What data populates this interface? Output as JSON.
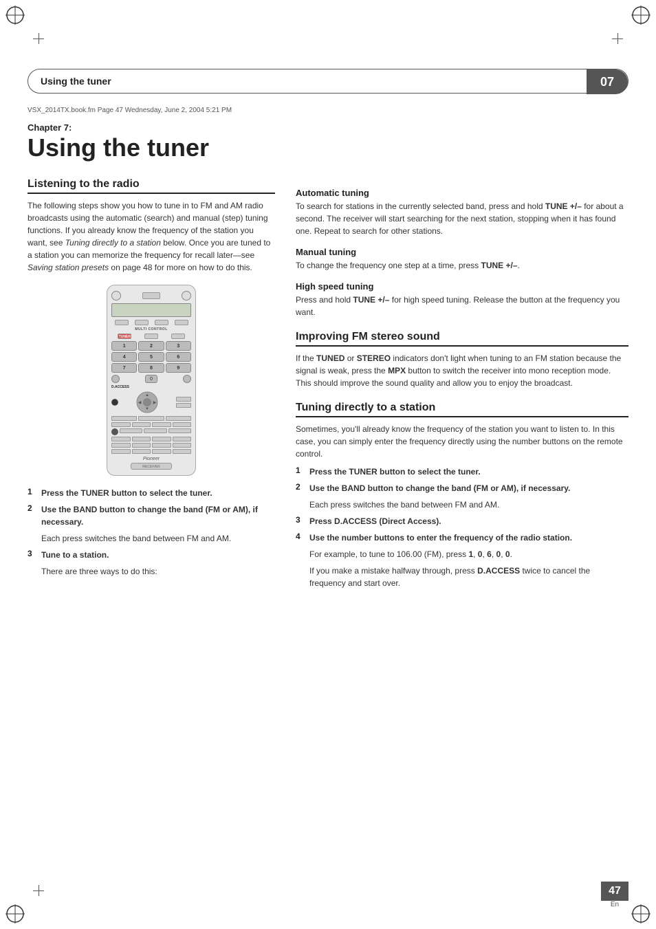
{
  "page": {
    "file_info": "VSX_2014TX.book.fm  Page 47  Wednesday, June 2, 2004  5:21 PM",
    "header_title": "Using the tuner",
    "chapter_num": "07",
    "chapter_label": "Chapter 7:",
    "chapter_title": "Using the tuner",
    "page_number": "47",
    "page_lang": "En"
  },
  "left_col": {
    "section_title": "Listening to the radio",
    "intro_text": "The following steps show you how to tune in to FM and AM radio broadcasts using the automatic (search) and manual (step) tuning functions. If you already know the frequency of the station you want, see Tuning directly to a station below. Once you are tuned to a station you can memorize the frequency for recall later—see Saving station presets on page 48 for more on how to do this.",
    "steps": [
      {
        "num": "1",
        "bold": "Press the TUNER button to select the tuner."
      },
      {
        "num": "2",
        "bold": "Use the BAND button to change the band (FM or AM), if necessary.",
        "sub": "Each press switches the band between FM and AM."
      },
      {
        "num": "3",
        "bold": "Tune to a station.",
        "sub": "There are three ways to do this:"
      }
    ]
  },
  "right_col": {
    "auto_tuning": {
      "heading": "Automatic tuning",
      "text": "To search for stations in the currently selected band, press and hold TUNE +/– for about a second. The receiver will start searching for the next station, stopping when it has found one. Repeat to search for other stations."
    },
    "manual_tuning": {
      "heading": "Manual tuning",
      "text": "To change the frequency one step at a time, press TUNE +/–."
    },
    "high_speed_tuning": {
      "heading": "High speed tuning",
      "text": "Press and hold TUNE +/– for high speed tuning. Release the button at the frequency you want."
    },
    "improving_fm": {
      "heading": "Improving FM stereo sound",
      "text": "If the TUNED or STEREO indicators don't light when tuning to an FM station because the signal is weak, press the MPX button to switch the receiver into mono reception mode. This should improve the sound quality and allow you to enjoy the broadcast."
    },
    "tuning_direct": {
      "heading": "Tuning directly to a station",
      "intro": "Sometimes, you'll already know the frequency of the station you want to listen to. In this case, you can simply enter the frequency directly using the number buttons on the remote control.",
      "steps": [
        {
          "num": "1",
          "text": "Press the TUNER button to select the tuner."
        },
        {
          "num": "2",
          "text": "Use the BAND button to change the band (FM or AM), if necessary.",
          "sub": "Each press switches the band between FM and AM."
        },
        {
          "num": "3",
          "text": "Press D.ACCESS (Direct Access)."
        },
        {
          "num": "4",
          "text": "Use the number buttons to enter the frequency of the radio station.",
          "sub1": "For example, to tune to 106.00 (FM), press 1, 0, 6, 0, 0.",
          "sub2": "If you make a mistake halfway through, press D.ACCESS twice to cancel the frequency and start over."
        }
      ]
    }
  },
  "remote": {
    "label": "MULTI CONTROL",
    "tuner_label": "TUNER",
    "numbers": [
      "1",
      "2",
      "3",
      "4",
      "5",
      "6",
      "7",
      "8",
      "9",
      "0"
    ],
    "daccess": "D.ACCESS",
    "brand": "Pioneer",
    "receiver_label": "RECEIVER"
  }
}
